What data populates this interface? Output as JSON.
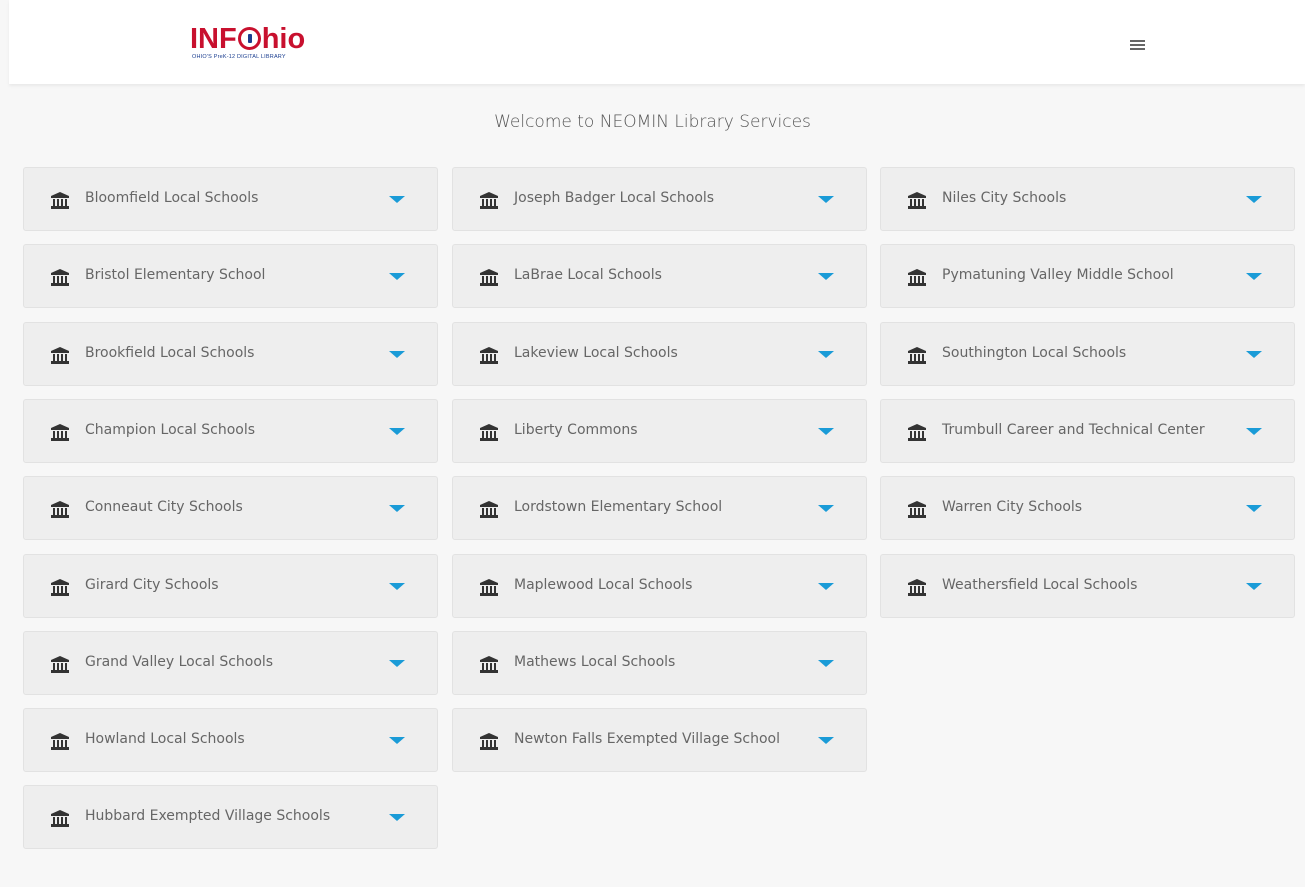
{
  "header": {
    "logo": {
      "part1": "INF",
      "part2": "hio",
      "tagline": "OHIO'S PreK-12 DIGITAL LIBRARY"
    },
    "menu_icon": "hamburger-menu-icon"
  },
  "welcome": "Welcome to NEOMIN Library Services",
  "accent_color": "#1a9bd7",
  "columns": [
    {
      "items": [
        "Bloomfield Local Schools",
        "Bristol Elementary School",
        "Brookfield Local Schools",
        "Champion Local Schools",
        "Conneaut City Schools",
        "Girard City Schools",
        "Grand Valley Local Schools",
        "Howland Local Schools",
        "Hubbard Exempted Village Schools"
      ]
    },
    {
      "items": [
        "Joseph Badger Local Schools",
        "LaBrae Local Schools",
        "Lakeview Local Schools",
        "Liberty Commons",
        "Lordstown Elementary School",
        "Maplewood Local Schools",
        "Mathews Local Schools",
        "Newton Falls Exempted Village School"
      ]
    },
    {
      "items": [
        "Niles City Schools",
        "Pymatuning Valley Middle School",
        "Southington Local Schools",
        "Trumbull Career and Technical Center",
        "Warren City Schools",
        "Weathersfield Local Schools"
      ]
    }
  ],
  "item_icon": "institution-icon",
  "expand_icon": "caret-down-icon"
}
